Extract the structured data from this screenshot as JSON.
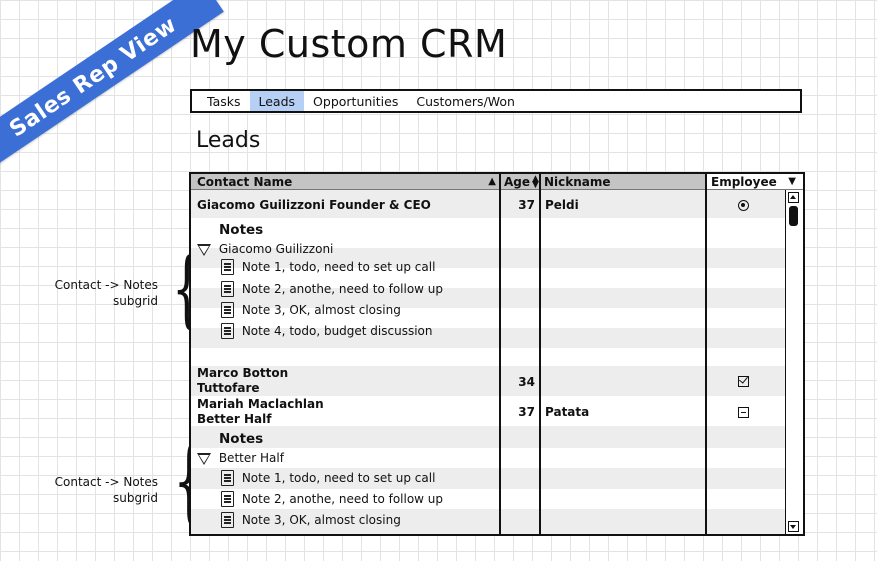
{
  "banner": "Sales Rep View",
  "app_title": "My Custom CRM",
  "tabs": [
    {
      "label": "Tasks",
      "active": false
    },
    {
      "label": "Leads",
      "active": true
    },
    {
      "label": "Opportunities",
      "active": false
    },
    {
      "label": "Customers/Won",
      "active": false
    }
  ],
  "section_title": "Leads",
  "grid": {
    "columns": {
      "contact": "Contact Name",
      "age": "Age",
      "nickname": "Nickname",
      "employee": "Employee"
    },
    "leads": [
      {
        "contact": "Giacomo Guilizzoni Founder & CEO",
        "age": "37",
        "nickname": "Peldi",
        "employee": "radio",
        "notes": {
          "title": "Notes",
          "group": "Giacomo Guilizzoni",
          "items": [
            "Note 1, todo, need to set up call",
            "Note 2, anothe, need to follow up",
            "Note 3, OK, almost closing",
            "Note 4, todo, budget discussion"
          ]
        }
      },
      {
        "contact_line1": "Marco Botton",
        "contact_line2": "Tuttofare",
        "age": "34",
        "nickname": "",
        "employee": "checked"
      },
      {
        "contact_line1": "Mariah Maclachlan",
        "contact_line2": "Better Half",
        "age": "37",
        "nickname": "Patata",
        "employee": "indeterminate",
        "notes": {
          "title": "Notes",
          "group": "Better Half",
          "items": [
            "Note 1, todo, need to set up call",
            "Note 2, anothe, need to follow up",
            "Note 3, OK, almost closing"
          ]
        }
      }
    ]
  },
  "annotations": [
    {
      "line1": "Contact -> Notes",
      "line2": "subgrid"
    },
    {
      "line1": "Contact -> Notes",
      "line2": "subgrid"
    }
  ]
}
